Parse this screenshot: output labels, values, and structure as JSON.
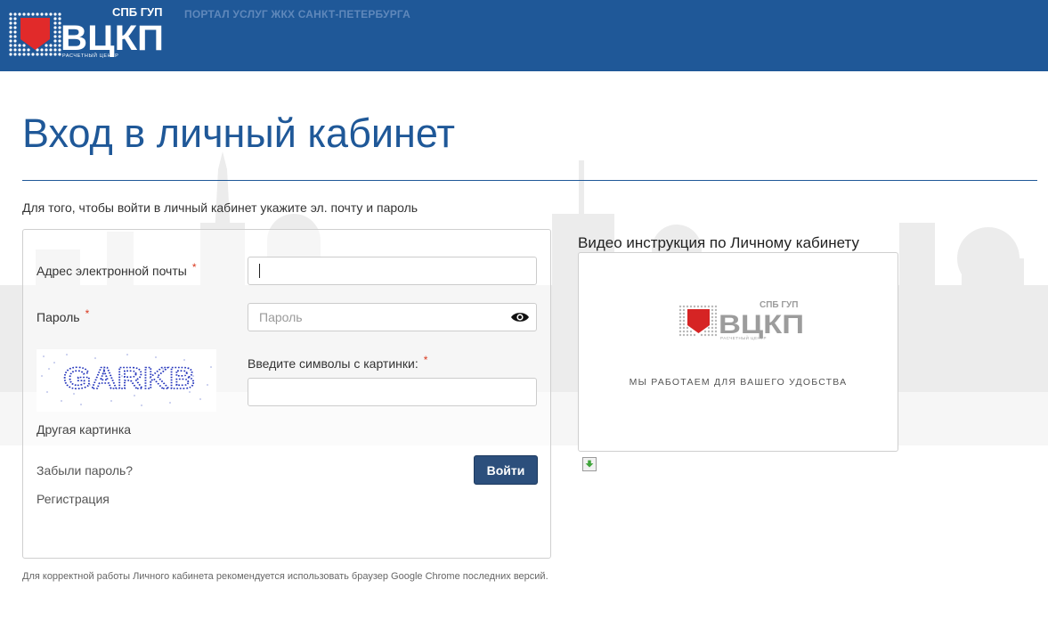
{
  "header": {
    "logo_text": "ВЦКП",
    "logo_top": "СПБ ГУП",
    "logo_bottom": "РАСЧЕТНЫЙ ЦЕНТР",
    "portal_title": "ПОРТАЛ УСЛУГ ЖКХ САНКТ-ПЕТЕРБУРГА"
  },
  "page": {
    "title": "Вход в личный кабинет",
    "intro": "Для того, чтобы войти в личный кабинет укажите эл. почту и пароль"
  },
  "form": {
    "email_label": "Адрес электронной почты",
    "email_value": "",
    "required_mark": "*",
    "password_label": "Пароль",
    "password_placeholder": "Пароль",
    "captcha_text": "GARKB",
    "captcha_label": "Введите символы с картинки:",
    "captcha_value": "",
    "other_picture": "Другая картинка",
    "forgot_password": "Забыли пароль?",
    "register": "Регистрация",
    "login_button": "Войти"
  },
  "video": {
    "title": "Видео инструкция по Личному кабинету",
    "caption": "МЫ РАБОТАЕМ ДЛЯ ВАШЕГО УДОБСТВА"
  },
  "footer": {
    "note": "Для корректной работы Личного кабинета рекомендуется использовать браузер Google Chrome последних версий."
  },
  "colors": {
    "header_bg": "#1f5898",
    "accent": "#1f5898",
    "button_bg": "#2c4f7c",
    "logo_red": "#e12a2a"
  },
  "icons": [
    "show-password-eye-icon",
    "download-icon"
  ]
}
